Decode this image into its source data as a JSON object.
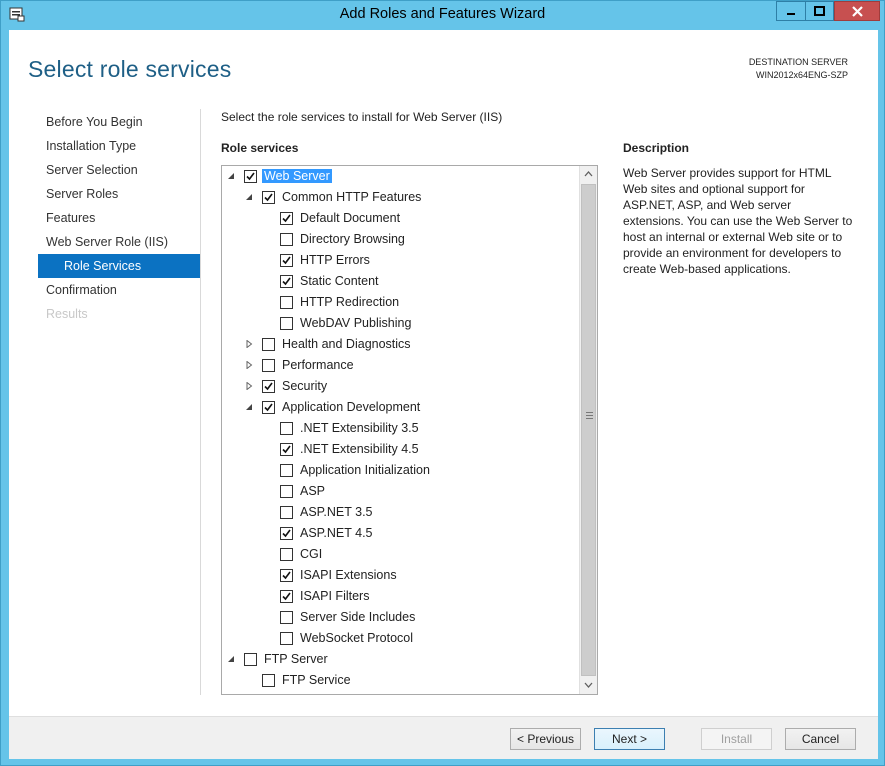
{
  "window": {
    "title": "Add Roles and Features Wizard",
    "controls": {
      "minimize": "minimize-icon",
      "maximize": "maximize-icon",
      "close": "close-icon"
    }
  },
  "header": {
    "heading": "Select role services",
    "destination_label": "DESTINATION SERVER",
    "destination_server": "WIN2012x64ENG-SZP"
  },
  "nav": {
    "items": [
      {
        "label": "Before You Begin",
        "state": "normal"
      },
      {
        "label": "Installation Type",
        "state": "normal"
      },
      {
        "label": "Server Selection",
        "state": "normal"
      },
      {
        "label": "Server Roles",
        "state": "normal"
      },
      {
        "label": "Features",
        "state": "normal"
      },
      {
        "label": "Web Server Role (IIS)",
        "state": "normal"
      },
      {
        "label": "Role Services",
        "state": "active"
      },
      {
        "label": "Confirmation",
        "state": "normal"
      },
      {
        "label": "Results",
        "state": "disabled"
      }
    ]
  },
  "main": {
    "instruction": "Select the role services to install for Web Server (IIS)",
    "role_services_label": "Role services",
    "tree": [
      {
        "label": "Web Server",
        "level": 0,
        "expander": "expanded",
        "checked": true,
        "selected": true
      },
      {
        "label": "Common HTTP Features",
        "level": 1,
        "expander": "expanded",
        "checked": true
      },
      {
        "label": "Default Document",
        "level": 2,
        "expander": "none",
        "checked": true
      },
      {
        "label": "Directory Browsing",
        "level": 2,
        "expander": "none",
        "checked": false
      },
      {
        "label": "HTTP Errors",
        "level": 2,
        "expander": "none",
        "checked": true
      },
      {
        "label": "Static Content",
        "level": 2,
        "expander": "none",
        "checked": true
      },
      {
        "label": "HTTP Redirection",
        "level": 2,
        "expander": "none",
        "checked": false
      },
      {
        "label": "WebDAV Publishing",
        "level": 2,
        "expander": "none",
        "checked": false
      },
      {
        "label": "Health and Diagnostics",
        "level": 1,
        "expander": "collapsed",
        "checked": false
      },
      {
        "label": "Performance",
        "level": 1,
        "expander": "collapsed",
        "checked": false
      },
      {
        "label": "Security",
        "level": 1,
        "expander": "collapsed",
        "checked": true
      },
      {
        "label": "Application Development",
        "level": 1,
        "expander": "expanded",
        "checked": true
      },
      {
        "label": ".NET Extensibility 3.5",
        "level": 2,
        "expander": "none",
        "checked": false
      },
      {
        "label": ".NET Extensibility 4.5",
        "level": 2,
        "expander": "none",
        "checked": true
      },
      {
        "label": "Application Initialization",
        "level": 2,
        "expander": "none",
        "checked": false
      },
      {
        "label": "ASP",
        "level": 2,
        "expander": "none",
        "checked": false
      },
      {
        "label": "ASP.NET 3.5",
        "level": 2,
        "expander": "none",
        "checked": false
      },
      {
        "label": "ASP.NET 4.5",
        "level": 2,
        "expander": "none",
        "checked": true
      },
      {
        "label": "CGI",
        "level": 2,
        "expander": "none",
        "checked": false
      },
      {
        "label": "ISAPI Extensions",
        "level": 2,
        "expander": "none",
        "checked": true
      },
      {
        "label": "ISAPI Filters",
        "level": 2,
        "expander": "none",
        "checked": true
      },
      {
        "label": "Server Side Includes",
        "level": 2,
        "expander": "none",
        "checked": false
      },
      {
        "label": "WebSocket Protocol",
        "level": 2,
        "expander": "none",
        "checked": false
      },
      {
        "label": "FTP Server",
        "level": 0,
        "expander": "expanded",
        "checked": false
      },
      {
        "label": "FTP Service",
        "level": 1,
        "expander": "none",
        "checked": false
      }
    ]
  },
  "description": {
    "label": "Description",
    "text": "Web Server provides support for HTML Web sites and optional support for ASP.NET, ASP, and Web server extensions. You can use the Web Server to host an internal or external Web site or to provide an environment for developers to create Web-based applications."
  },
  "footer": {
    "previous": "< Previous",
    "next": "Next >",
    "install": "Install",
    "cancel": "Cancel"
  },
  "colors": {
    "frame": "#65c4e9",
    "heading": "#1e5f86",
    "nav_active": "#0b72c2",
    "selection": "#3399ff"
  }
}
